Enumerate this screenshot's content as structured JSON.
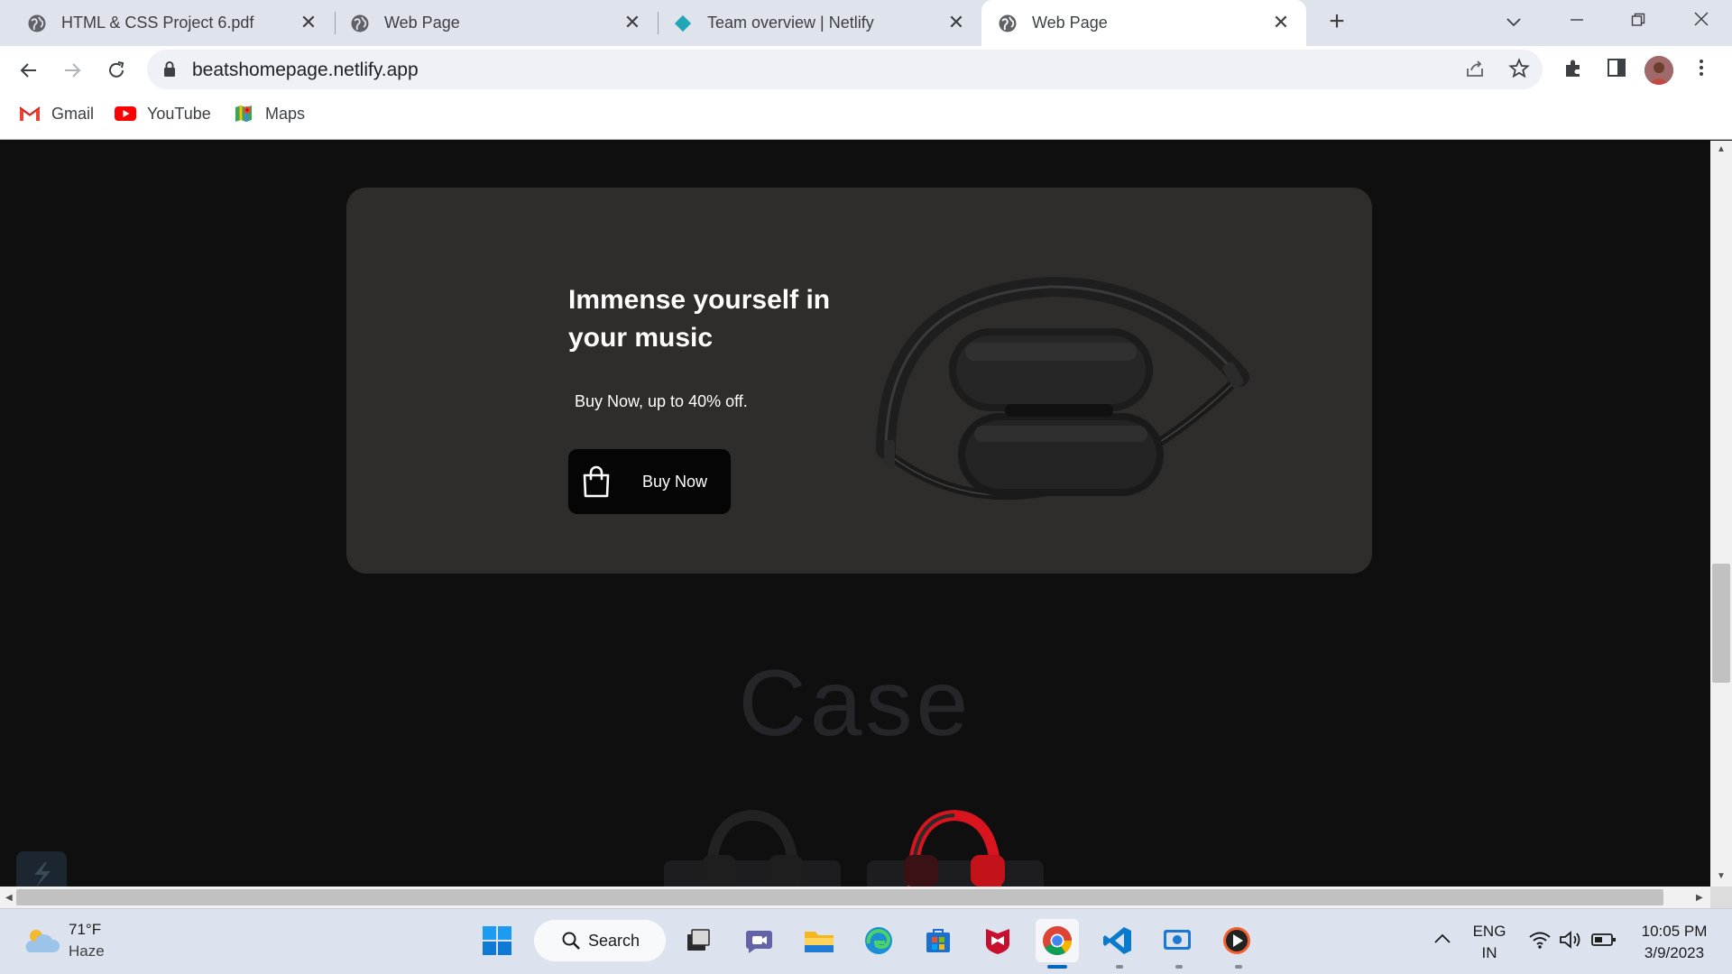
{
  "browser": {
    "tabs": [
      {
        "title": "HTML & CSS Project 6.pdf",
        "favicon": "globe-icon",
        "active": false
      },
      {
        "title": "Web Page",
        "favicon": "globe-icon",
        "active": false
      },
      {
        "title": "Team overview | Netlify",
        "favicon": "netlify-icon",
        "active": false
      },
      {
        "title": "Web Page",
        "favicon": "globe-icon",
        "active": true
      }
    ],
    "url": "beatshomepage.netlify.app",
    "bookmarks": [
      {
        "label": "Gmail",
        "icon": "gmail-icon"
      },
      {
        "label": "YouTube",
        "icon": "youtube-icon"
      },
      {
        "label": "Maps",
        "icon": "maps-icon"
      }
    ]
  },
  "page": {
    "hero": {
      "title": "Immense yourself in your music",
      "subtitle": "Buy Now, up to 40% off.",
      "button_label": "Buy Now",
      "image": "headphones-image"
    },
    "case_heading": "Case",
    "case_items": [
      "black-headphones-image",
      "red-headphones-image"
    ]
  },
  "taskbar": {
    "weather": {
      "temp": "71°F",
      "condition": "Haze"
    },
    "search_label": "Search",
    "apps": [
      "start-icon",
      "task-view-icon",
      "teams-icon",
      "file-explorer-icon",
      "edge-icon",
      "store-icon",
      "mcafee-icon",
      "chrome-icon",
      "vscode-icon",
      "screen-recorder-icon",
      "media-player-icon"
    ],
    "language": {
      "line1": "ENG",
      "line2": "IN"
    },
    "time": "10:05 PM",
    "date": "3/9/2023"
  },
  "colors": {
    "page_bg": "#0f0f10",
    "hero_bg": "#2e2d2c",
    "button_bg": "#050505",
    "accent_blue": "#0067c0"
  }
}
